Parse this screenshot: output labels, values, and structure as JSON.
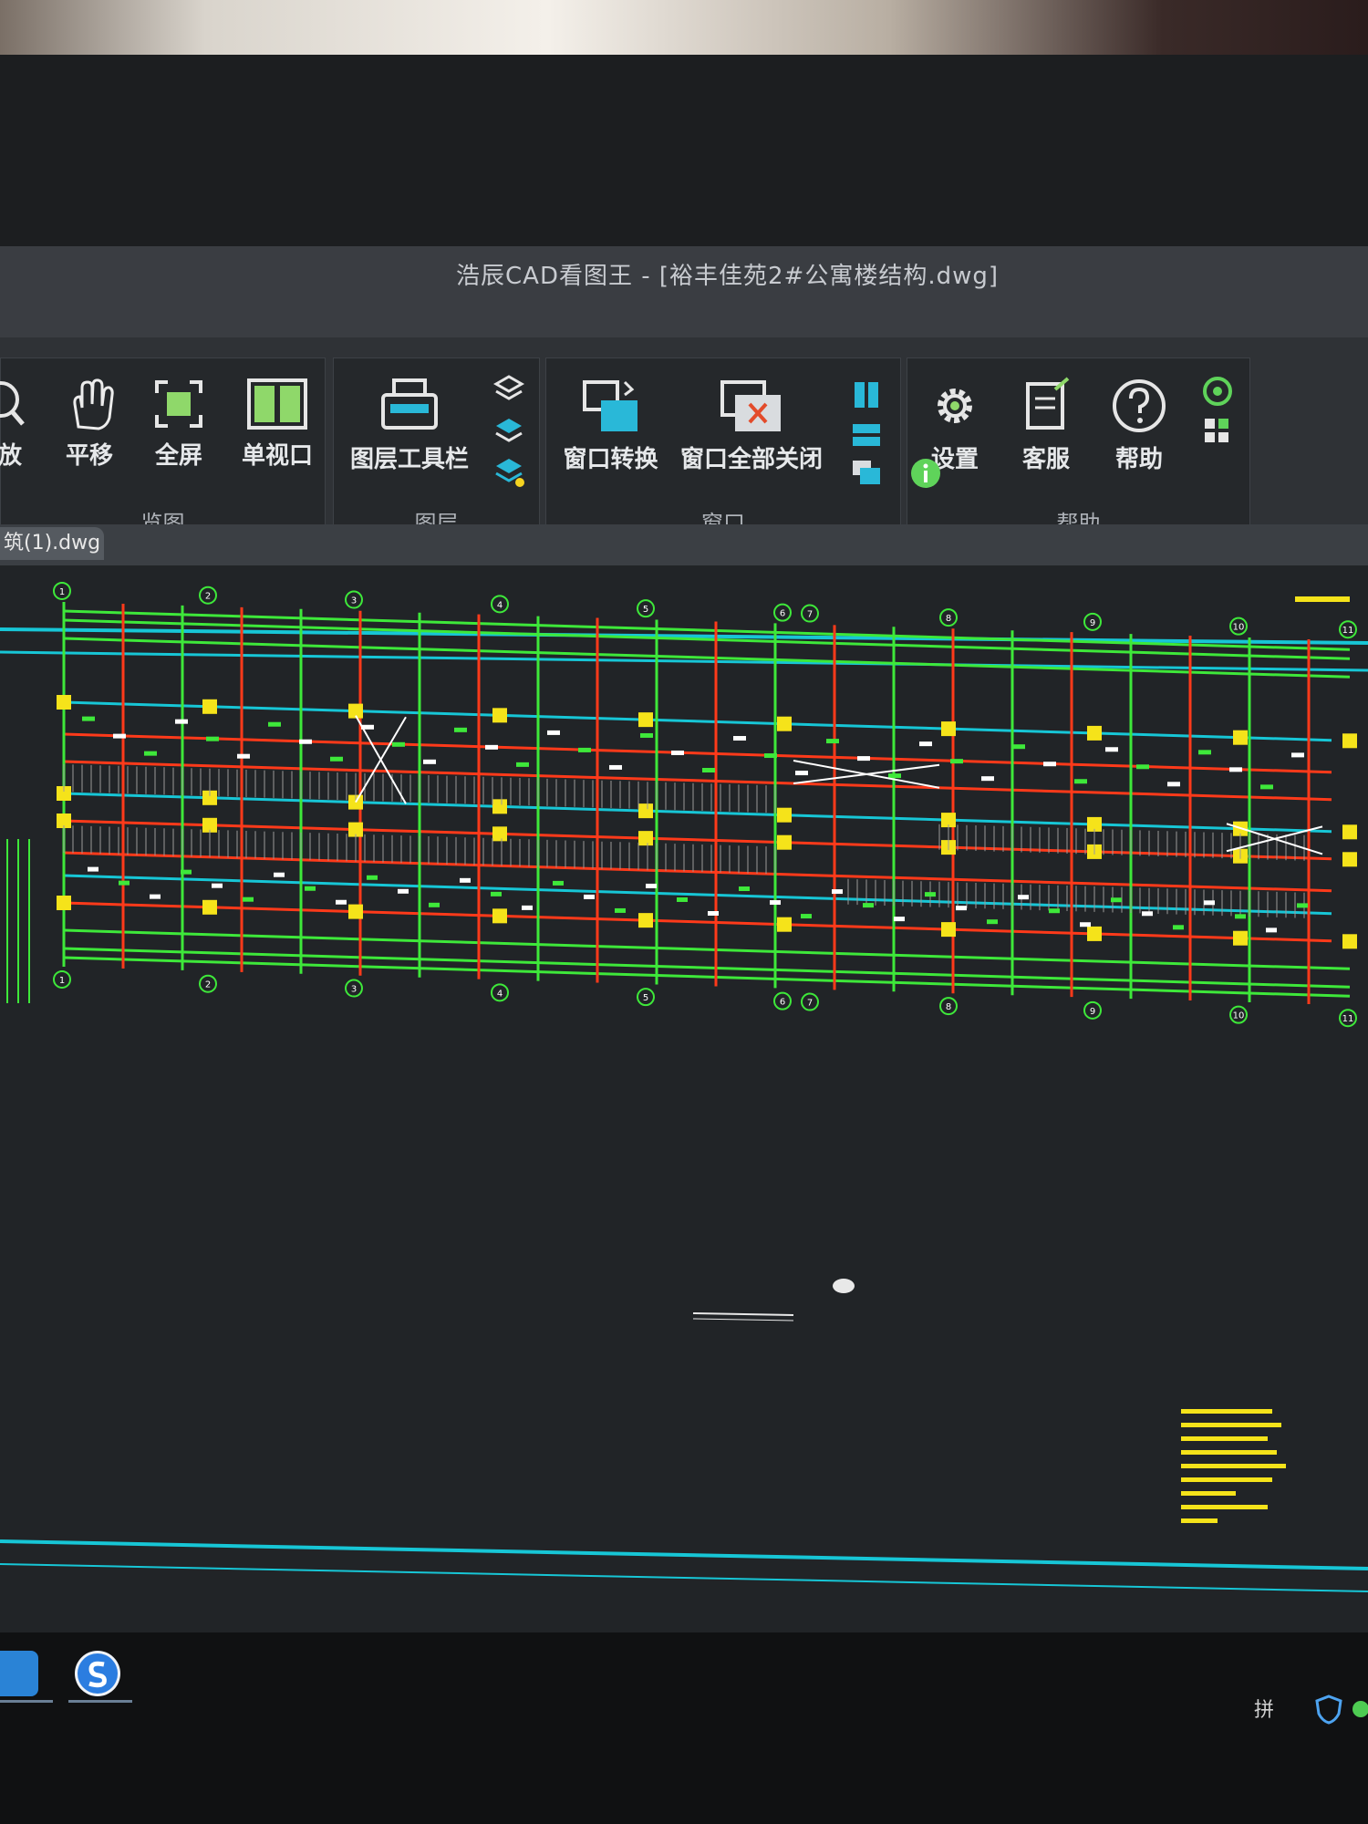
{
  "window": {
    "title": "浩辰CAD看图王 - [裕丰佳苑2#公寓楼结构.dwg]"
  },
  "ribbon": {
    "groups": [
      {
        "label": "览图",
        "tools": [
          {
            "label": "放"
          },
          {
            "label": "平移"
          },
          {
            "label": "全屏"
          },
          {
            "label": "单视口"
          }
        ]
      },
      {
        "label": "图层",
        "tools": [
          {
            "label": "图层工具栏"
          }
        ]
      },
      {
        "label": "窗口",
        "tools": [
          {
            "label": "窗口转换"
          },
          {
            "label": "窗口全部关闭"
          }
        ]
      },
      {
        "label": "帮助",
        "tools": [
          {
            "label": "设置"
          },
          {
            "label": "客服"
          },
          {
            "label": "帮助"
          }
        ]
      }
    ]
  },
  "document_tab": {
    "label": "筑(1).dwg"
  },
  "drawing": {
    "grid_top": [
      "1",
      "2",
      "3",
      "4",
      "5",
      "6",
      "7",
      "8",
      "9",
      "10",
      "11"
    ],
    "grid_bottom": [
      "1",
      "2",
      "3",
      "4",
      "5",
      "6",
      "7",
      "8",
      "9",
      "10",
      "11"
    ]
  },
  "taskbar": {
    "ime_label": "拼"
  },
  "colors": {
    "green": "#3ee83a",
    "red": "#ff3a1a",
    "cyan": "#17c6d6",
    "yellow": "#f5e31a"
  },
  "icons": [
    "zoom-icon",
    "hand-pan-icon",
    "fullscreen-icon",
    "single-viewport-icon",
    "layer-toolbar-icon",
    "window-switch-icon",
    "close-all-windows-icon",
    "settings-gear-icon",
    "customer-service-icon",
    "help-question-icon",
    "info-icon"
  ]
}
